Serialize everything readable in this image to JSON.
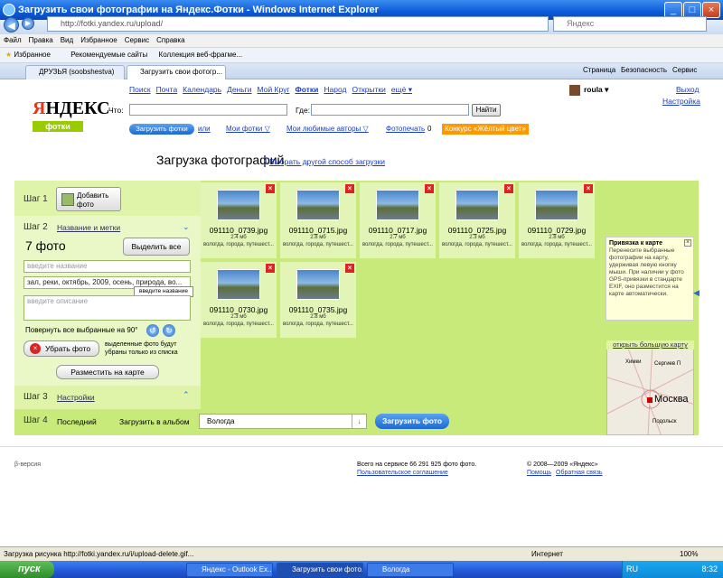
{
  "window": {
    "title": "Загрузить свои фотографии на Яндекс.Фотки - Windows Internet Explorer"
  },
  "browser": {
    "url": "http://fotki.yandex.ru/upload/",
    "search_placeholder": "Яндекс",
    "menu": [
      "Файл",
      "Правка",
      "Вид",
      "Избранное",
      "Сервис",
      "Справка"
    ],
    "favorites_label": "Избранное",
    "fav_links": [
      "Рекомендуемые сайты",
      "Коллекция веб-фрагме..."
    ],
    "tabs": [
      "ДРУЗЬЯ (soobshestva)",
      "Загрузить свои фотогр..."
    ],
    "toolbar": [
      "Страница",
      "Безопасность",
      "Сервис"
    ]
  },
  "header": {
    "logo": {
      "main_first": "Я",
      "main_rest": "НДЕКС",
      "sub": "фотки"
    },
    "nav": [
      "Поиск",
      "Почта",
      "Календарь",
      "Деньги",
      "Мой Круг",
      "Фотки",
      "Народ",
      "Открытки",
      "ещё ▾"
    ],
    "what_label": "Что:",
    "where_label": "Где:",
    "find_button": "Найти",
    "user": "roula ▾",
    "exit": "Выход",
    "settings": "Настройка",
    "upload_button": "Загрузить фотки",
    "or": "или",
    "my_photos": "Мои фотки ▽",
    "fav_authors": "Мои любимые авторы ▽",
    "photoprint": "Фотопечать",
    "photoprint_count": "0",
    "contest": "Конкурс «Жёлтый цвет»"
  },
  "page": {
    "title": "Загрузка фотографий",
    "alt_method": "Выбрать другой способ загрузки"
  },
  "steps": {
    "step1": {
      "label": "Шаг 1",
      "button": "Добавить фото"
    },
    "step2": {
      "label": "Шаг 2",
      "name": "Название и метки",
      "count": "7 фото",
      "select_all": "Выделить все",
      "title_placeholder": "введите название",
      "tags_value": "зал, реки, октябрь, 2009, осень, природа, во...",
      "desc_placeholder": "введите описание",
      "tooltip": "введите название",
      "rotate_label": "Повернуть все выбранные на 90°",
      "remove_button": "Убрать фото",
      "remove_note": "выделенные фото будут убраны только из списка",
      "map_button": "Разместить на карте"
    },
    "step3": {
      "label": "Шаг 3",
      "name": "Настройки"
    },
    "step4": {
      "label": "Шаг 4",
      "last": "Последний",
      "album_label": "Загрузить в альбом",
      "album": "Вологда",
      "upload": "Загрузить фото"
    }
  },
  "photos": [
    {
      "name": "091110_0739.jpg",
      "size": "2.4 мб",
      "tags": "вологда, города, путешест..."
    },
    {
      "name": "091110_0715.jpg",
      "size": "2.8 мб",
      "tags": "вологда, города, путешест..."
    },
    {
      "name": "091110_0717.jpg",
      "size": "2.7 мб",
      "tags": "вологда, города, путешест..."
    },
    {
      "name": "091110_0725.jpg",
      "size": "2.3 мб",
      "tags": "вологда, города, путешест..."
    },
    {
      "name": "091110_0729.jpg",
      "size": "2.8 мб",
      "tags": "вологда, города, путешест..."
    },
    {
      "name": "091110_0730.jpg",
      "size": "2.3 мб",
      "tags": "вологда, города, путешест..."
    },
    {
      "name": "091110_0735.jpg",
      "size": "2.8 мб",
      "tags": "вологда, города, путешест..."
    }
  ],
  "geo": {
    "title": "Привязка к карте",
    "text": "Перенесите выбранные фотографии на карту, удерживая левую кнопку мыши. При наличии у фото GPS-привязки в стандарте EXIF, оно разместится на карте автоматически.",
    "map_link": "открыть большую карту",
    "city": "Москва",
    "places": [
      "Химки",
      "Сергиев П",
      "Подольск"
    ]
  },
  "footer": {
    "beta": "β-версия",
    "total": "Всего на сервисе 66 291 925 фото фото.",
    "agreement": "Пользовательское соглашение",
    "copyright": "© 2008—2009 «Яндекс»",
    "help": "Помощь",
    "feedback": "Обратная связь"
  },
  "status": {
    "text": "Загрузка рисунка http://fotki.yandex.ru/i/upload-delete.gif...",
    "zone": "Интернет",
    "zoom": "100%"
  },
  "taskbar": {
    "start": "пуск",
    "tasks": [
      "Яндекс - Outlook Ex...",
      "Загрузить свои фото...",
      "Вологда"
    ],
    "lang": "RU",
    "time": "8:32"
  },
  "colors": {
    "panel": "#c7ea7a",
    "left": "#dff3a9",
    "link": "#1a3dc1",
    "contest": "#ff9900"
  }
}
